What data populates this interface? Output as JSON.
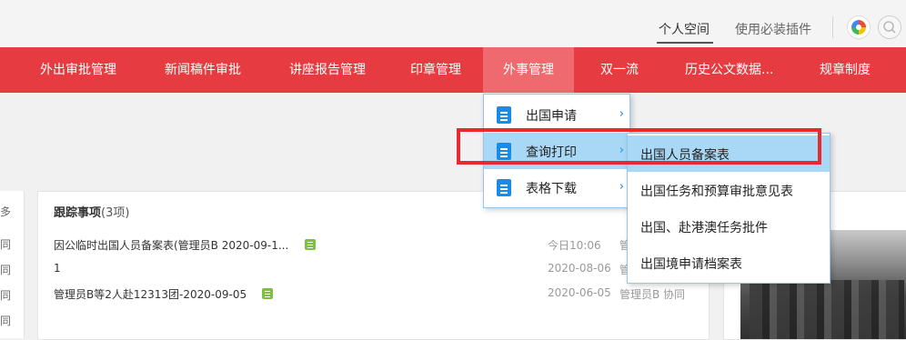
{
  "top_links": {
    "personal_space": "个人空间",
    "plugins": "使用必装插件"
  },
  "icons": {
    "color": "color-wheel-icon",
    "search": "search-icon",
    "doc": "document-icon",
    "chevron": "chevron-right-icon"
  },
  "nav": [
    "外出审批管理",
    "新闻稿件审批",
    "讲座报告管理",
    "印章管理",
    "外事管理",
    "双一流",
    "历史公文数据...",
    "规章制度"
  ],
  "nav_selected": "外事管理",
  "side_strip": [
    "多",
    "同",
    "同",
    "同",
    "同"
  ],
  "tracking": {
    "title": "跟踪事项",
    "count": "(3项)",
    "rows": [
      {
        "title": "因公临时出国人员备案表(管理员B 2020-09-1...",
        "date": "今日10:06",
        "user": "管"
      },
      {
        "title": "1",
        "date": "2020-08-06",
        "user": "管"
      },
      {
        "title": "管理员B等2人赴12313团-2020-09-05",
        "date": "2020-06-05",
        "user": "管理员B  协同"
      }
    ]
  },
  "menu_level1": [
    "出国申请",
    "查询打印",
    "表格下载"
  ],
  "menu_level2": [
    "出国人员备案表",
    "出国任务和预算审批意见表",
    "出国、赴港澳任务批件",
    "出国境申请档案表"
  ],
  "colors": {
    "nav_bg": "#e63b41",
    "highlight": "#a8d8f5",
    "red_box": "#e62a2f"
  }
}
